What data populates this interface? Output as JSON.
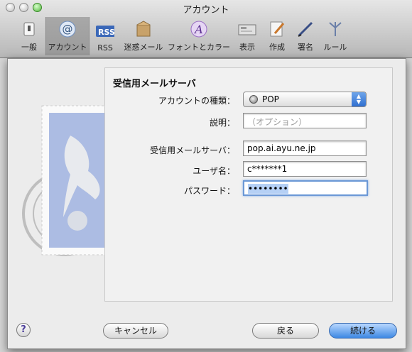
{
  "window": {
    "title": "アカウント"
  },
  "toolbar": {
    "items": [
      {
        "label": "一般",
        "icon": "switch-icon"
      },
      {
        "label": "アカウント",
        "icon": "at-icon"
      },
      {
        "label": "RSS",
        "icon": "rss-icon"
      },
      {
        "label": "迷惑メール",
        "icon": "junk-mail-icon"
      },
      {
        "label": "フォントとカラー",
        "icon": "font-color-icon"
      },
      {
        "label": "表示",
        "icon": "display-icon"
      },
      {
        "label": "作成",
        "icon": "compose-icon"
      },
      {
        "label": "署名",
        "icon": "signature-icon"
      },
      {
        "label": "ルール",
        "icon": "rules-icon"
      }
    ]
  },
  "sheet": {
    "title": "受信用メールサーバ",
    "account_type": {
      "label": "アカウントの種類：",
      "value": "POP"
    },
    "description": {
      "label": "説明：",
      "placeholder": "（オプション）"
    },
    "server": {
      "label": "受信用メールサーバ：",
      "value": "pop.ai.ayu.ne.jp"
    },
    "username": {
      "label": "ユーザ名：",
      "value": "c*******1"
    },
    "password": {
      "label": "パスワード：",
      "value": "••••••••"
    }
  },
  "buttons": {
    "help": "?",
    "cancel": "キャンセル",
    "back": "戻る",
    "continue": "続ける"
  },
  "colors": {
    "accent": "#3d88e3",
    "focus_ring": "#6b98d6"
  }
}
